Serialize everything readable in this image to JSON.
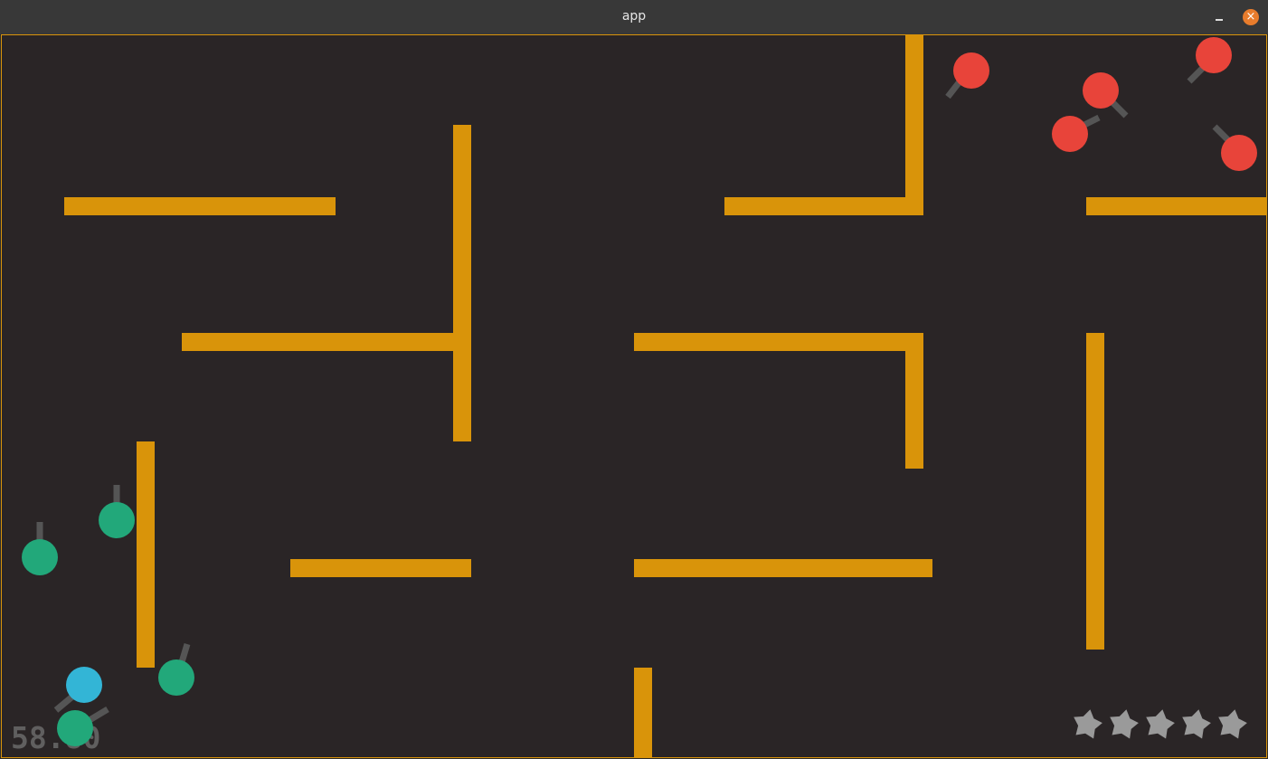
{
  "window": {
    "title": "app",
    "close_symbol": "×"
  },
  "hud": {
    "timer": "58.80",
    "lives": 5,
    "lives_icon": "star-icon"
  },
  "colors": {
    "background": "#2a2526",
    "wall": "#d9940a",
    "enemy": "#e8443a",
    "ally": "#22a87a",
    "player": "#33b5d6",
    "barrel": "#555555",
    "star": "#9a9a9a"
  }
}
